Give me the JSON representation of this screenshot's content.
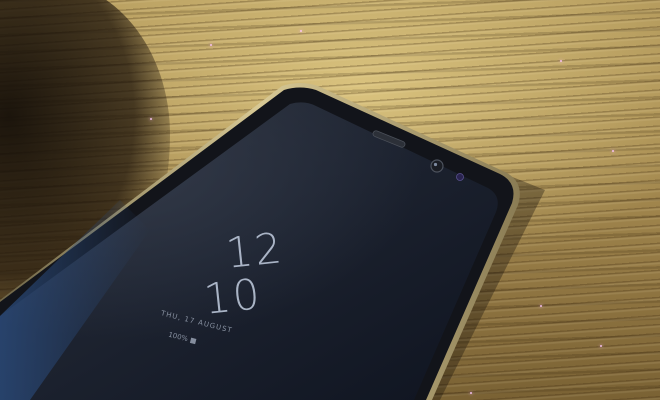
{
  "photo": {
    "subject": "smartphone-on-wooden-table",
    "palette": {
      "wood_light": "#c9ad6a",
      "wood_dark": "#7a6234",
      "phone_body": "#14161c",
      "screen": "#1c2230",
      "bezel_edge": "#c9b98a",
      "screen_text": "#b9c4d6"
    }
  },
  "lock_screen": {
    "hour": "12",
    "minute": "10",
    "date_line": "THU, 17 AUGUST",
    "status_line": "100% ■"
  }
}
